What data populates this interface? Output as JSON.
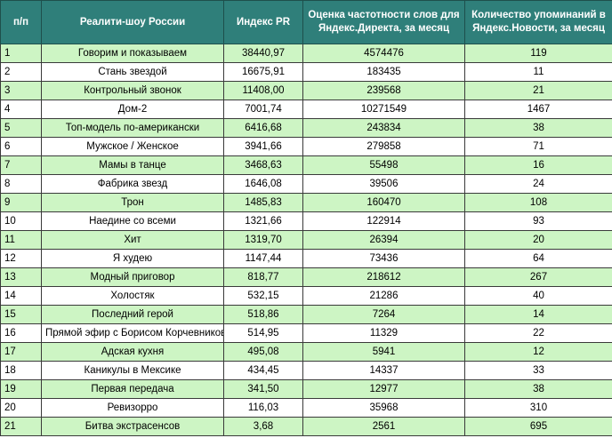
{
  "headers": [
    "п/п",
    "Реалити-шоу России",
    "Индекс PR",
    "Оценка частотности слов для Яндекс.Директа, за месяц",
    "Количество упоминаний в Яндекс.Новости, за месяц"
  ],
  "rows": [
    {
      "n": "1",
      "show": "Говорим и показываем",
      "pr": "38440,97",
      "freq": "4574476",
      "news": "119"
    },
    {
      "n": "2",
      "show": "Стань звездой",
      "pr": "16675,91",
      "freq": "183435",
      "news": "11"
    },
    {
      "n": "3",
      "show": "Контрольный звонок",
      "pr": "11408,00",
      "freq": "239568",
      "news": "21"
    },
    {
      "n": "4",
      "show": "Дом-2",
      "pr": "7001,74",
      "freq": "10271549",
      "news": "1467"
    },
    {
      "n": "5",
      "show": "Топ-модель по-американски",
      "pr": "6416,68",
      "freq": "243834",
      "news": "38"
    },
    {
      "n": "6",
      "show": "Мужское / Женское",
      "pr": "3941,66",
      "freq": "279858",
      "news": "71"
    },
    {
      "n": "7",
      "show": "Мамы в танце",
      "pr": "3468,63",
      "freq": "55498",
      "news": "16"
    },
    {
      "n": "8",
      "show": "Фабрика звезд",
      "pr": "1646,08",
      "freq": "39506",
      "news": "24"
    },
    {
      "n": "9",
      "show": "Трон",
      "pr": "1485,83",
      "freq": "160470",
      "news": "108"
    },
    {
      "n": "10",
      "show": "Наедине со всеми",
      "pr": "1321,66",
      "freq": "122914",
      "news": "93"
    },
    {
      "n": "11",
      "show": "Хит",
      "pr": "1319,70",
      "freq": "26394",
      "news": "20"
    },
    {
      "n": "12",
      "show": "Я худею",
      "pr": "1147,44",
      "freq": "73436",
      "news": "64"
    },
    {
      "n": "13",
      "show": "Модный приговор",
      "pr": "818,77",
      "freq": "218612",
      "news": "267"
    },
    {
      "n": "14",
      "show": "Холостяк",
      "pr": "532,15",
      "freq": "21286",
      "news": "40"
    },
    {
      "n": "15",
      "show": "Последний герой",
      "pr": "518,86",
      "freq": "7264",
      "news": "14"
    },
    {
      "n": "16",
      "show": "Прямой эфир с Борисом Корчевниковым",
      "pr": "514,95",
      "freq": "11329",
      "news": "22"
    },
    {
      "n": "17",
      "show": "Адская кухня",
      "pr": "495,08",
      "freq": "5941",
      "news": "12"
    },
    {
      "n": "18",
      "show": "Каникулы в Мексике",
      "pr": "434,45",
      "freq": "14337",
      "news": "33"
    },
    {
      "n": "19",
      "show": "Первая передача",
      "pr": "341,50",
      "freq": "12977",
      "news": "38"
    },
    {
      "n": "20",
      "show": "Ревизорро",
      "pr": "116,03",
      "freq": "35968",
      "news": "310"
    },
    {
      "n": "21",
      "show": "Битва экстрасенсов",
      "pr": "3,68",
      "freq": "2561",
      "news": "695"
    }
  ]
}
